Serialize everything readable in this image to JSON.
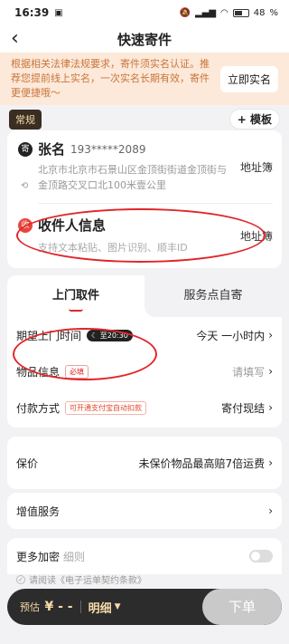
{
  "status_bar": {
    "time": "16:39",
    "battery": "48"
  },
  "nav": {
    "title": "快速寄件"
  },
  "notice": {
    "text": "根据相关法律法规要求，寄件须实名认证。推荐您提前线上实名，一次实名长期有效，寄件更便捷哦～",
    "button": "立即实名"
  },
  "tag_regular": "常规",
  "template_button": "+ 模板",
  "sender": {
    "badge": "寄",
    "name": "张名",
    "phone": "193*****2089",
    "address": "北京市北京市石景山区金顶街街道金顶街与金顶路交叉口北100米壹公里",
    "book": "地址簿"
  },
  "receiver": {
    "badge": "收",
    "label": "收件人信息",
    "hint": "支持文本粘贴、图片识别、顺丰ID",
    "book": "地址簿"
  },
  "tabs": {
    "pickup": "上门取件",
    "self_send": "服务点自寄"
  },
  "rows": {
    "expected_time_label": "期望上门时间",
    "expected_time_pill": "至20:30",
    "expected_time_value": "今天 一小时内",
    "item_info_label": "物品信息",
    "item_info_required": "必填",
    "item_info_value": "请填写",
    "payment_label": "付款方式",
    "payment_pill": "可开通支付宝自动扣款",
    "payment_value": "寄付现结"
  },
  "insurance": {
    "label": "保价",
    "value": "未保价物品最高赔7倍运费"
  },
  "added_services": {
    "label": "增值服务"
  },
  "more_encryption": {
    "label": "更多加密",
    "sub": "细则"
  },
  "agree": {
    "text": "请阅读《电子运单契约条款》"
  },
  "bottom": {
    "price_label": "预估",
    "price_value": "¥ - -",
    "detail": "明细",
    "submit": "下单"
  }
}
